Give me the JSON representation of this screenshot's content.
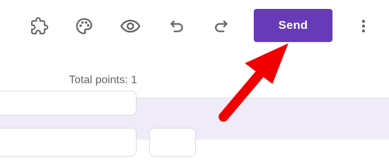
{
  "toolbar": {
    "icons": [
      "add-ons-icon",
      "palette-icon",
      "preview-icon",
      "undo-icon",
      "redo-icon"
    ],
    "send_label": "Send",
    "more_icon": "more-vert-icon",
    "accent_color": "#673ab7"
  },
  "form": {
    "total_points": "Total points: 1"
  },
  "annotation": {
    "arrow_color": "#f00000",
    "arrow_icon": "red-pointer-arrow"
  }
}
